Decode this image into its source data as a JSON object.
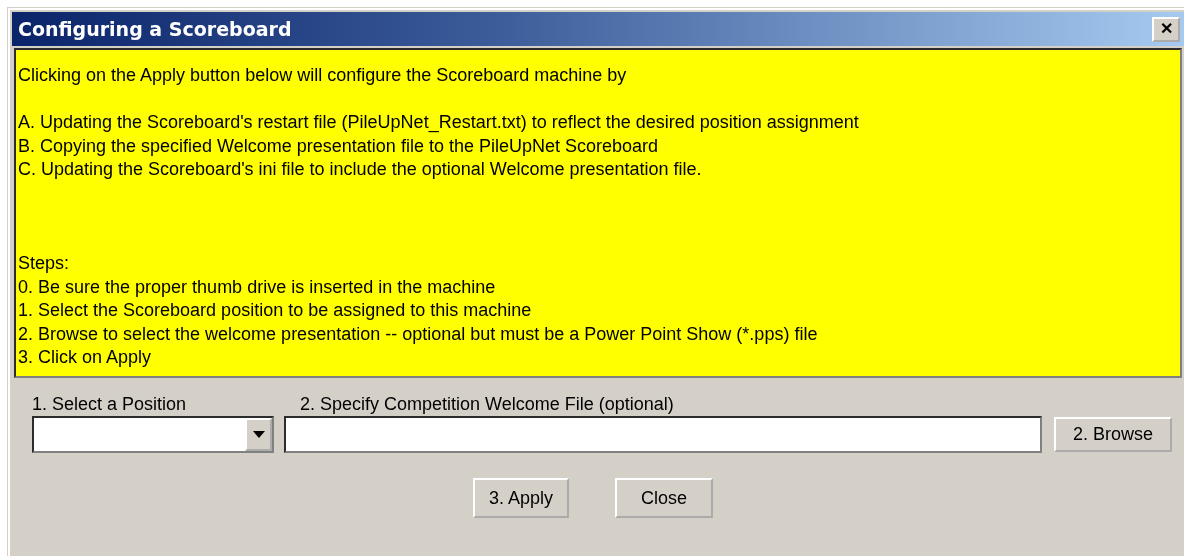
{
  "window": {
    "title": "Configuring a Scoreboard",
    "close_glyph": "✕"
  },
  "instructions": [
    {
      "kind": "intro",
      "lines": [
        "Clicking on the Apply button below will configure the Scoreboard machine by"
      ]
    },
    {
      "kind": "list",
      "lines": [
        "A. Updating the Scoreboard's restart file (PileUpNet_Restart.txt) to reflect the desired position assignment",
        "B. Copying the specified Welcome presentation file to the PileUpNet Scoreboard",
        "C. Updating the Scoreboard's ini file to include the optional Welcome presentation file."
      ]
    },
    {
      "kind": "steps",
      "lines": [
        "Steps:",
        "0. Be sure the proper thumb drive is inserted in the machine",
        "1. Select the Scoreboard position to be assigned to this machine",
        "2. Browse to select the welcome presentation -- optional but must be a Power Point Show (*.pps) file",
        "3. Click on Apply"
      ]
    }
  ],
  "position": {
    "label": "1. Select a Position"
  },
  "welcome_file": {
    "label": "2. Specify Competition Welcome File (optional)",
    "browse": "2. Browse"
  },
  "buttons": [
    "3. Apply",
    "Close"
  ]
}
